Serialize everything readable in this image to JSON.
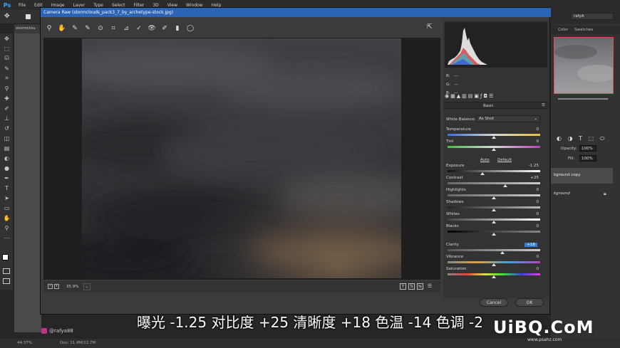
{
  "app": {
    "logo": "Ps",
    "menus": [
      "File",
      "Edit",
      "Image",
      "Layer",
      "Type",
      "Select",
      "Filter",
      "3D",
      "View",
      "Window",
      "Help"
    ],
    "doc_tab": "stormclou",
    "account": "rafyA"
  },
  "right_panels": {
    "tabs": [
      "Color",
      "Swatches"
    ],
    "opacity_label": "Opacity:",
    "opacity_value": "100%",
    "fill_label": "Fill:",
    "fill_value": "100%",
    "layers": [
      "kground copy",
      "kground"
    ]
  },
  "status": {
    "zoom": "44.37%",
    "doc": "Doc: 11.4M/22.7M"
  },
  "dialog": {
    "title": "Camera Raw (stormclouds_pack3_7_by_archetype-stock.jpg)",
    "zoom": "35.9%",
    "cancel_label": "Cancel",
    "ok_label": "OK",
    "panel_title": "Basic",
    "rgb": {
      "r_label": "R:",
      "g_label": "G:",
      "b_label": "B:",
      "r": "---",
      "g": "---",
      "b": "---"
    },
    "white_balance_label": "White Balance:",
    "white_balance_value": "As Shot",
    "auto_label": "Auto",
    "default_label": "Default",
    "sliders": [
      {
        "label": "Temperature",
        "value": "0",
        "fraction": 0.5
      },
      {
        "label": "Tint",
        "value": "0",
        "fraction": 0.5
      },
      {
        "label": "Exposure",
        "value": "-1.25",
        "fraction": 0.375
      },
      {
        "label": "Contrast",
        "value": "+25",
        "fraction": 0.625
      },
      {
        "label": "Highlights",
        "value": "0",
        "fraction": 0.5
      },
      {
        "label": "Shadows",
        "value": "0",
        "fraction": 0.5
      },
      {
        "label": "Whites",
        "value": "0",
        "fraction": 0.5
      },
      {
        "label": "Blacks",
        "value": "0",
        "fraction": 0.5
      },
      {
        "label": "Clarity",
        "value": "+18",
        "fraction": 0.59
      },
      {
        "label": "Vibrance",
        "value": "0",
        "fraction": 0.5
      },
      {
        "label": "Saturation",
        "value": "0",
        "fraction": 0.5
      }
    ]
  },
  "caption": "曝光 -1.25 对比度 +25 清晰度 +18 色温 -14 色调 -2",
  "handle": "@rafya88",
  "watermark": "UiBQ.CoM",
  "watermark_sub": "www.psahz.com",
  "colors": {
    "title_bar": "#2b63b5",
    "accent": "#31a8ff",
    "selection": "#2f7fd6"
  }
}
